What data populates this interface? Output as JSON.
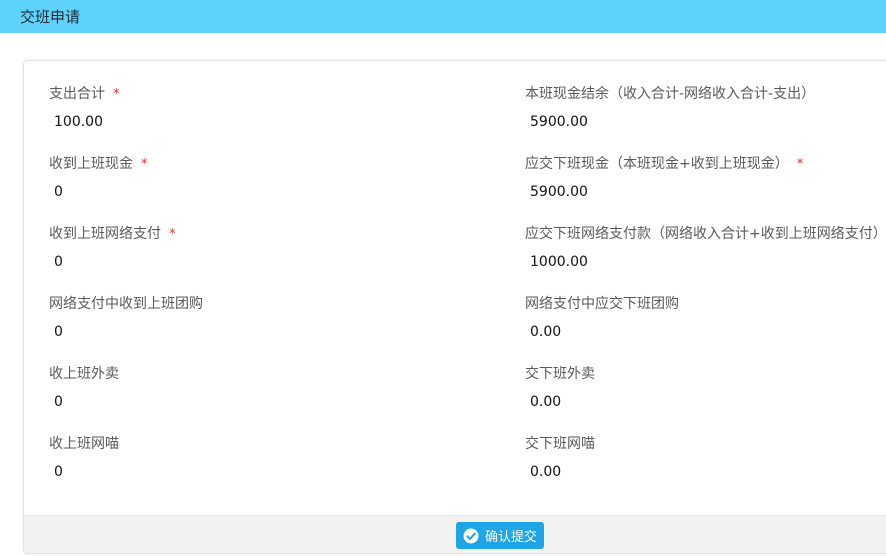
{
  "window": {
    "title": "交班申请"
  },
  "form": {
    "left": [
      {
        "label": "支出合计",
        "required": "*",
        "value": "100.00"
      },
      {
        "label": "收到上班现金",
        "required": "*",
        "value": "0"
      },
      {
        "label": "收到上班网络支付",
        "required": "*",
        "value": "0"
      },
      {
        "label": "网络支付中收到上班团购",
        "required": "",
        "value": "0"
      },
      {
        "label": "收上班外卖",
        "required": "",
        "value": "0"
      },
      {
        "label": "收上班网喵",
        "required": "",
        "value": "0"
      }
    ],
    "right": [
      {
        "label": "本班现金结余（收入合计-网络收入合计-支出）",
        "required": "",
        "value": "5900.00"
      },
      {
        "label": "应交下班现金（本班现金+收到上班现金）",
        "required": "*",
        "value": "5900.00"
      },
      {
        "label": "应交下班网络支付款（网络收入合计+收到上班网络支付）",
        "required": "",
        "value": "1000.00"
      },
      {
        "label": "网络支付中应交下班团购",
        "required": "",
        "value": "0.00"
      },
      {
        "label": "交下班外卖",
        "required": "",
        "value": "0.00"
      },
      {
        "label": "交下班网喵",
        "required": "",
        "value": "0.00"
      }
    ]
  },
  "footer": {
    "submit_label": "确认提交",
    "submit_icon": "check-circle-icon"
  },
  "colors": {
    "titlebar": "#5fd2fb",
    "button": "#1ea5e6",
    "required": "#e0312c"
  }
}
